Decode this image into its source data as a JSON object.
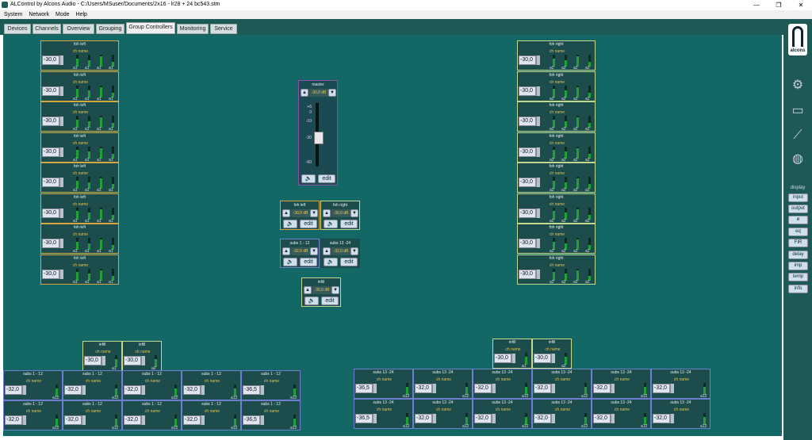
{
  "window": {
    "title": "ALControl by Alcons Audio - C:/Users/MSuser/Documents/2x16 - lr28 + 24 bc543.stm",
    "btn_min": "—",
    "btn_max": "❐",
    "btn_close": "✕"
  },
  "menu": [
    "System",
    "Network",
    "Mode",
    "Help"
  ],
  "tabs": [
    "Devices",
    "Channels",
    "Overview",
    "Grouping",
    "Group Controllers",
    "Monitoring",
    "Service"
  ],
  "active_tab": 4,
  "brand": {
    "logo_text": "alcons"
  },
  "icons": {
    "settings": "gear-icon",
    "network": "network-icon",
    "link": "link-icon",
    "globe": "globe-icon"
  },
  "display": {
    "label": "display",
    "buttons": [
      "input",
      "output",
      "ø",
      "eq",
      "FIR",
      "delay",
      "imp",
      "temp",
      "info"
    ]
  },
  "common": {
    "ch_name": "ch name",
    "edit": "edit",
    "speaker_glyph": "🔈",
    "up": "▲",
    "down": "▼"
  },
  "master": {
    "title": "master",
    "value": "-30,0 dB",
    "scale": [
      "+6",
      "0",
      "-10",
      "-30",
      "-60"
    ],
    "fader_level": 0.55
  },
  "controllers": [
    {
      "title": "foh left",
      "value": "-30,0 dB"
    },
    {
      "title": "foh right",
      "value": "-30,0 dB"
    },
    {
      "title": "subs 1 - 12",
      "value": "-32,0 dB"
    },
    {
      "title": "subs 13 -24",
      "value": "-32,0 dB"
    },
    {
      "title": "infill",
      "value": "-30,0 dB"
    }
  ],
  "groups": {
    "foh_left": {
      "title": "foh left",
      "value": "-30,0",
      "labels": [
        "a1",
        "a1",
        "a1",
        "a1"
      ],
      "count": 8
    },
    "foh_right": {
      "title": "foh right",
      "value": "-30,0",
      "labels": [
        "a2",
        "a2",
        "a2",
        "a2"
      ],
      "count": 8
    },
    "infill_left": [
      {
        "title": "infill",
        "value": "-30,0",
        "label": "a1"
      },
      {
        "title": "infill",
        "value": "-30,0",
        "label": "a2"
      }
    ],
    "infill_right": [
      {
        "title": "infill",
        "value": "-30,0",
        "label": "a1"
      },
      {
        "title": "infill",
        "value": "-30,0",
        "label": "a2"
      }
    ],
    "subs_left": {
      "title": "subs 1 - 12",
      "values": [
        "-32,0",
        "-32,0",
        "-32,0",
        "-32,0",
        "-36,5"
      ],
      "label": "a12"
    },
    "subs_right": {
      "title": "subs 13 -24",
      "values": [
        "-36,5",
        "-32,0",
        "-32,0",
        "-32,0",
        "-32,0",
        "-32,0"
      ],
      "label": "a12"
    }
  },
  "colors": {
    "workspace": "#136764",
    "chrome": "#1e5a55",
    "foh_left_border": "#d6a640",
    "foh_right_border": "#c4da8a",
    "subs_border": "#6e7fd0",
    "master_border": "#8e4fa8",
    "meter_green": "#22a037",
    "value_text": "#f2c94c"
  }
}
